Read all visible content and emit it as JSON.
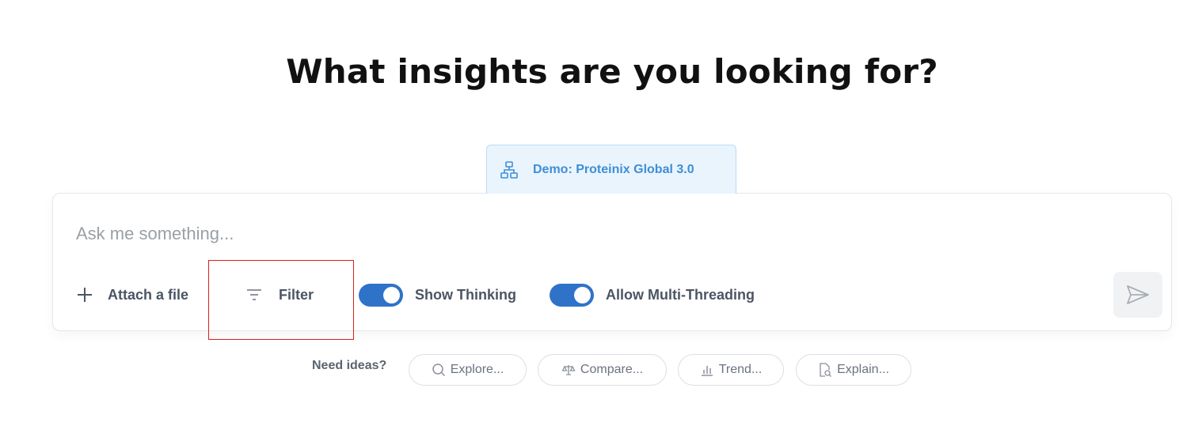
{
  "header": {
    "title": "What insights are you looking for?"
  },
  "dataset_tab": {
    "label": "Demo: Proteinix Global 3.0",
    "icon": "sitemap-icon"
  },
  "chat": {
    "placeholder": "Ask me something...",
    "value": "",
    "attach_label": "Attach a file",
    "filter_label": "Filter",
    "show_thinking_label": "Show Thinking",
    "show_thinking_on": true,
    "multi_threading_label": "Allow Multi-Threading",
    "multi_threading_on": true,
    "send_icon": "send-icon"
  },
  "ideas": {
    "label": "Need ideas?",
    "chips": [
      {
        "label": "Explore...",
        "icon": "search-icon"
      },
      {
        "label": "Compare...",
        "icon": "scale-icon"
      },
      {
        "label": "Trend...",
        "icon": "bar-chart-icon"
      },
      {
        "label": "Explain...",
        "icon": "document-search-icon"
      }
    ]
  },
  "colors": {
    "accent": "#2f73c8",
    "tab_bg": "#eaf4fd",
    "tab_text": "#3d8fd6",
    "highlight": "#d92020"
  }
}
